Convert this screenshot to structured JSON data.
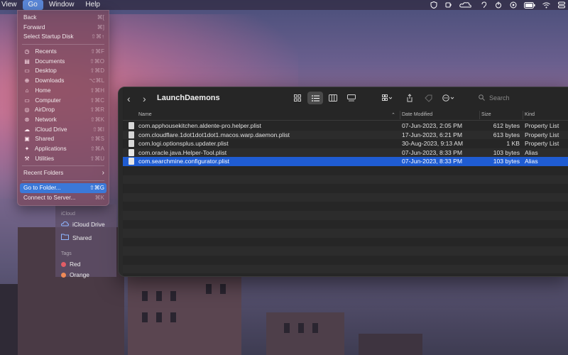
{
  "menubar": {
    "items": [
      "View",
      "Go",
      "Window",
      "Help"
    ],
    "active_index": 1,
    "status_icons": [
      "shield-icon",
      "cup-icon",
      "cloud-icon",
      "ear-icon",
      "power-icon",
      "play-icon",
      "battery-icon",
      "wifi-icon",
      "control-center-icon"
    ]
  },
  "go_menu": {
    "section1": [
      {
        "label": "Back",
        "shortcut": "⌘["
      },
      {
        "label": "Forward",
        "shortcut": "⌘]"
      },
      {
        "label": "Select Startup Disk",
        "shortcut": "⇧⌘↑"
      }
    ],
    "section2": [
      {
        "label": "Recents",
        "shortcut": "⇧⌘F",
        "icon": "clock-icon"
      },
      {
        "label": "Documents",
        "shortcut": "⇧⌘O",
        "icon": "document-icon"
      },
      {
        "label": "Desktop",
        "shortcut": "⇧⌘D",
        "icon": "desktop-icon"
      },
      {
        "label": "Downloads",
        "shortcut": "⌥⌘L",
        "icon": "download-icon"
      },
      {
        "label": "Home",
        "shortcut": "⇧⌘H",
        "icon": "home-icon"
      },
      {
        "label": "Computer",
        "shortcut": "⇧⌘C",
        "icon": "computer-icon"
      },
      {
        "label": "AirDrop",
        "shortcut": "⇧⌘R",
        "icon": "airdrop-icon"
      },
      {
        "label": "Network",
        "shortcut": "⇧⌘K",
        "icon": "network-icon"
      },
      {
        "label": "iCloud Drive",
        "shortcut": "⇧⌘I",
        "icon": "icloud-icon"
      },
      {
        "label": "Shared",
        "shortcut": "⇧⌘S",
        "icon": "shared-folder-icon"
      },
      {
        "label": "Applications",
        "shortcut": "⇧⌘A",
        "icon": "applications-icon"
      },
      {
        "label": "Utilities",
        "shortcut": "⇧⌘U",
        "icon": "utilities-icon"
      }
    ],
    "recent_folders": "Recent Folders",
    "go_to_folder": {
      "label": "Go to Folder...",
      "shortcut": "⇧⌘G"
    },
    "connect_server": {
      "label": "Connect to Server...",
      "shortcut": "⌘K"
    }
  },
  "finder": {
    "title": "LaunchDaemons",
    "search_placeholder": "Search",
    "columns": {
      "name": "Name",
      "date": "Date Modified",
      "size": "Size",
      "kind": "Kind"
    },
    "files": [
      {
        "name": "com.apphousekitchen.aldente-pro.helper.plist",
        "date": "07-Jun-2023, 2:05 PM",
        "size": "612 bytes",
        "kind": "Property List"
      },
      {
        "name": "com.cloudflare.1dot1dot1dot1.macos.warp.daemon.plist",
        "date": "17-Jun-2023, 6:21 PM",
        "size": "613 bytes",
        "kind": "Property List"
      },
      {
        "name": "com.logi.optionsplus.updater.plist",
        "date": "30-Aug-2023, 9:13 AM",
        "size": "1 KB",
        "kind": "Property List"
      },
      {
        "name": "com.oracle.java.Helper-Tool.plist",
        "date": "07-Jun-2023, 8:33 PM",
        "size": "103 bytes",
        "kind": "Alias"
      },
      {
        "name": "com.searchmine.configurator.plist",
        "date": "07-Jun-2023, 8:33 PM",
        "size": "103 bytes",
        "kind": "Alias"
      }
    ],
    "selected_index": 4
  },
  "sidebar": {
    "icloud_header": "iCloud",
    "icloud_drive": "iCloud Drive",
    "shared": "Shared",
    "tags_header": "Tags",
    "tag_red": "Red",
    "tag_orange": "Orange"
  }
}
